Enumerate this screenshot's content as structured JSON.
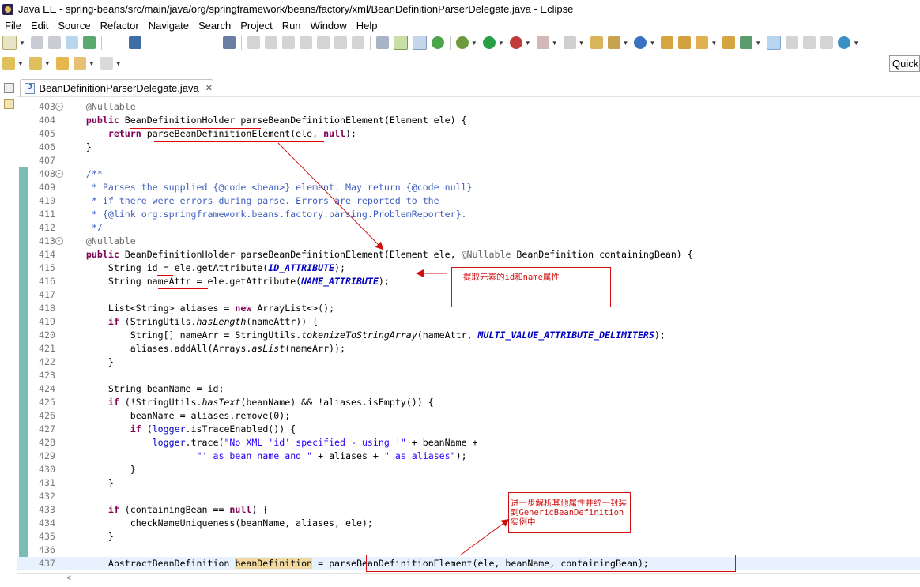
{
  "window": {
    "title": "Java EE - spring-beans/src/main/java/org/springframework/beans/factory/xml/BeanDefinitionParserDelegate.java - Eclipse"
  },
  "menu": [
    "File",
    "Edit",
    "Source",
    "Refactor",
    "Navigate",
    "Search",
    "Project",
    "Run",
    "Window",
    "Help"
  ],
  "quick_access": {
    "label": "Quick"
  },
  "editor_tab": {
    "label": "BeanDefinitionParserDelegate.java",
    "close_glyph": "✕"
  },
  "colors": {
    "keyword": "#7f0055",
    "comment": "#3f5fbf",
    "string": "#2a00ff",
    "field": "#0000c0",
    "annotation_red": "#d01010",
    "occurrence_highlight": "#f2d9a0",
    "change_bar": "#7bbcb4"
  },
  "lines": [
    {
      "n": "403",
      "fold": "⊖",
      "segs": [
        {
          "t": "    "
        },
        {
          "t": "@Nullable",
          "c": "ann"
        }
      ]
    },
    {
      "n": "404",
      "segs": [
        {
          "t": "    "
        },
        {
          "t": "public",
          "c": "kw"
        },
        {
          "t": " BeanDefinitionHolder parseBeanDefinitionElement(Element ele) {"
        }
      ]
    },
    {
      "n": "405",
      "segs": [
        {
          "t": "        "
        },
        {
          "t": "return",
          "c": "kw"
        },
        {
          "t": " parseBeanDefinitionElement(ele, "
        },
        {
          "t": "null",
          "c": "kw"
        },
        {
          "t": ");"
        }
      ]
    },
    {
      "n": "406",
      "segs": [
        {
          "t": "    }"
        }
      ]
    },
    {
      "n": "407",
      "segs": []
    },
    {
      "n": "408",
      "fold": "⊖",
      "segs": [
        {
          "t": "    "
        },
        {
          "t": "/**",
          "c": "cm"
        }
      ]
    },
    {
      "n": "409",
      "segs": [
        {
          "t": "     * Parses the supplied {@code <bean>} element. May return {@code null}",
          "c": "cm"
        }
      ]
    },
    {
      "n": "410",
      "segs": [
        {
          "t": "     * if there were errors during parse. Errors are reported to the",
          "c": "cm"
        }
      ]
    },
    {
      "n": "411",
      "segs": [
        {
          "t": "     * {@link org.springframework.beans.factory.parsing.ProblemReporter}.",
          "c": "cm"
        }
      ]
    },
    {
      "n": "412",
      "segs": [
        {
          "t": "     */",
          "c": "cm"
        }
      ]
    },
    {
      "n": "413",
      "fold": "⊖",
      "segs": [
        {
          "t": "    "
        },
        {
          "t": "@Nullable",
          "c": "ann"
        }
      ]
    },
    {
      "n": "414",
      "segs": [
        {
          "t": "    "
        },
        {
          "t": "public",
          "c": "kw"
        },
        {
          "t": " BeanDefinitionHolder parseBeanDefinitionElement(Element ele, "
        },
        {
          "t": "@Nullable",
          "c": "ann"
        },
        {
          "t": " BeanDefinition containingBean) {"
        }
      ]
    },
    {
      "n": "415",
      "segs": [
        {
          "t": "        String id = ele.getAttribute("
        },
        {
          "t": "ID_ATTRIBUTE",
          "c": "cst"
        },
        {
          "t": ");"
        }
      ]
    },
    {
      "n": "416",
      "segs": [
        {
          "t": "        String nameAttr = ele.getAttribute("
        },
        {
          "t": "NAME_ATTRIBUTE",
          "c": "cst"
        },
        {
          "t": ");"
        }
      ]
    },
    {
      "n": "417",
      "segs": []
    },
    {
      "n": "418",
      "segs": [
        {
          "t": "        List<String> aliases = "
        },
        {
          "t": "new",
          "c": "kw"
        },
        {
          "t": " ArrayList<>();"
        }
      ]
    },
    {
      "n": "419",
      "segs": [
        {
          "t": "        "
        },
        {
          "t": "if",
          "c": "kw"
        },
        {
          "t": " (StringUtils."
        },
        {
          "t": "hasLength",
          "c": "st"
        },
        {
          "t": "(nameAttr)) {"
        }
      ]
    },
    {
      "n": "420",
      "segs": [
        {
          "t": "            String[] nameArr = StringUtils."
        },
        {
          "t": "tokenizeToStringArray",
          "c": "st"
        },
        {
          "t": "(nameAttr, "
        },
        {
          "t": "MULTI_VALUE_ATTRIBUTE_DELIMITERS",
          "c": "cst"
        },
        {
          "t": ");"
        }
      ]
    },
    {
      "n": "421",
      "segs": [
        {
          "t": "            aliases.addAll(Arrays."
        },
        {
          "t": "asList",
          "c": "st"
        },
        {
          "t": "(nameArr));"
        }
      ]
    },
    {
      "n": "422",
      "segs": [
        {
          "t": "        }"
        }
      ]
    },
    {
      "n": "423",
      "segs": []
    },
    {
      "n": "424",
      "segs": [
        {
          "t": "        String beanName = id;"
        }
      ]
    },
    {
      "n": "425",
      "segs": [
        {
          "t": "        "
        },
        {
          "t": "if",
          "c": "kw"
        },
        {
          "t": " (!StringUtils."
        },
        {
          "t": "hasText",
          "c": "st"
        },
        {
          "t": "(beanName) && !aliases.isEmpty()) {"
        }
      ]
    },
    {
      "n": "426",
      "segs": [
        {
          "t": "            beanName = aliases.remove(0);"
        }
      ]
    },
    {
      "n": "427",
      "segs": [
        {
          "t": "            "
        },
        {
          "t": "if",
          "c": "kw"
        },
        {
          "t": " ("
        },
        {
          "t": "logger",
          "c": "fld"
        },
        {
          "t": ".isTraceEnabled()) {"
        }
      ]
    },
    {
      "n": "428",
      "segs": [
        {
          "t": "                "
        },
        {
          "t": "logger",
          "c": "fld"
        },
        {
          "t": ".trace("
        },
        {
          "t": "\"No XML 'id' specified - using '\"",
          "c": "str"
        },
        {
          "t": " + beanName +"
        }
      ]
    },
    {
      "n": "429",
      "segs": [
        {
          "t": "                        "
        },
        {
          "t": "\"' as bean name and \"",
          "c": "str"
        },
        {
          "t": " + aliases + "
        },
        {
          "t": "\" as aliases\"",
          "c": "str"
        },
        {
          "t": ");"
        }
      ]
    },
    {
      "n": "430",
      "segs": [
        {
          "t": "            }"
        }
      ]
    },
    {
      "n": "431",
      "segs": [
        {
          "t": "        }"
        }
      ]
    },
    {
      "n": "432",
      "segs": []
    },
    {
      "n": "433",
      "segs": [
        {
          "t": "        "
        },
        {
          "t": "if",
          "c": "kw"
        },
        {
          "t": " (containingBean == "
        },
        {
          "t": "null",
          "c": "kw"
        },
        {
          "t": ") {"
        }
      ]
    },
    {
      "n": "434",
      "segs": [
        {
          "t": "            checkNameUniqueness(beanName, aliases, ele);"
        }
      ]
    },
    {
      "n": "435",
      "segs": [
        {
          "t": "        }"
        }
      ]
    },
    {
      "n": "436",
      "segs": []
    },
    {
      "n": "437",
      "cur": true,
      "segs": [
        {
          "t": "        AbstractBeanDefinition "
        },
        {
          "t": "beanDefinition",
          "c": "hl"
        },
        {
          "t": " = parseBeanDefinitionElement(ele, beanName, containingBean);"
        }
      ]
    }
  ],
  "notes": {
    "note1": "提取元素的id和name属性",
    "note2": "进一步解析其他属性并统一封装到GenericBeanDefinition实例中"
  }
}
